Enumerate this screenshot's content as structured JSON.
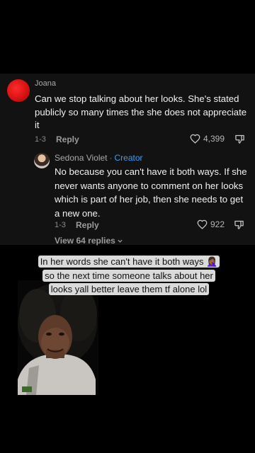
{
  "comment": {
    "username": "Joana",
    "text": "Can we stop talking about her looks. She's stated publicly so many times the she does not appreciate it",
    "date": "1-3",
    "reply_label": "Reply",
    "likes": "4,399"
  },
  "reply": {
    "username": "Sedona Violet",
    "separator": "·",
    "badge": "Creator",
    "text": "No because you can't have it both ways. If she never wants anyone to comment on her looks which is part of her job, then she needs to get a new one.",
    "date": "1-3",
    "reply_label": "Reply",
    "likes": "922"
  },
  "view_replies": "View 64 replies",
  "caption": {
    "line1": "In her words she can't have it both ways 🤦🏾‍♀️",
    "line2": "so the next time someone talks about her",
    "line3": "looks yall better leave them tf alone lol"
  },
  "icons": {
    "like": "heart-icon",
    "dislike": "thumbs-down-icon",
    "expand": "chevron-down-icon"
  }
}
